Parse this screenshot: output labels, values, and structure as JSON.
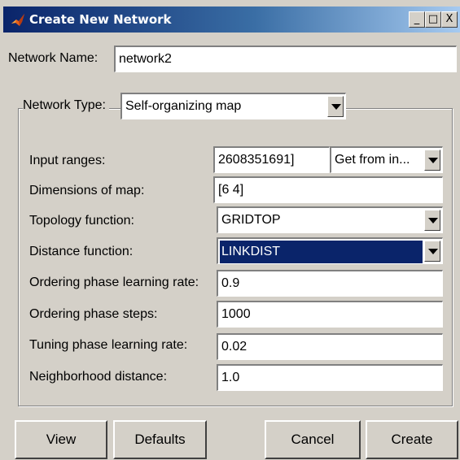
{
  "window": {
    "title": "Create New Network",
    "controls": {
      "minimize": "_",
      "maximize": "□",
      "close": "X"
    }
  },
  "network_name": {
    "label": "Network Name:",
    "value": "network2"
  },
  "network_type": {
    "label": "Network Type:",
    "value": "Self-organizing map"
  },
  "params": [
    {
      "label": "Input ranges:",
      "value": "2608351691]",
      "extra_select": "Get from in..."
    },
    {
      "label": "Dimensions of map:",
      "value": "[6 4]"
    },
    {
      "label": "Topology function:",
      "value": "GRIDTOP"
    },
    {
      "label": "Distance function:",
      "value": "LINKDIST"
    },
    {
      "label": "Ordering phase learning rate:",
      "value": "0.9"
    },
    {
      "label": "Ordering phase steps:",
      "value": "1000"
    },
    {
      "label": "Tuning phase learning rate:",
      "value": "0.02"
    },
    {
      "label": "Neighborhood distance:",
      "value": "1.0"
    }
  ],
  "buttons": {
    "view": "View",
    "defaults": "Defaults",
    "cancel": "Cancel",
    "create": "Create"
  },
  "colors": {
    "titlebar_start": "#0a246a",
    "titlebar_end": "#a6caf0",
    "selection": "#0a246a",
    "face": "#d4d0c8"
  }
}
